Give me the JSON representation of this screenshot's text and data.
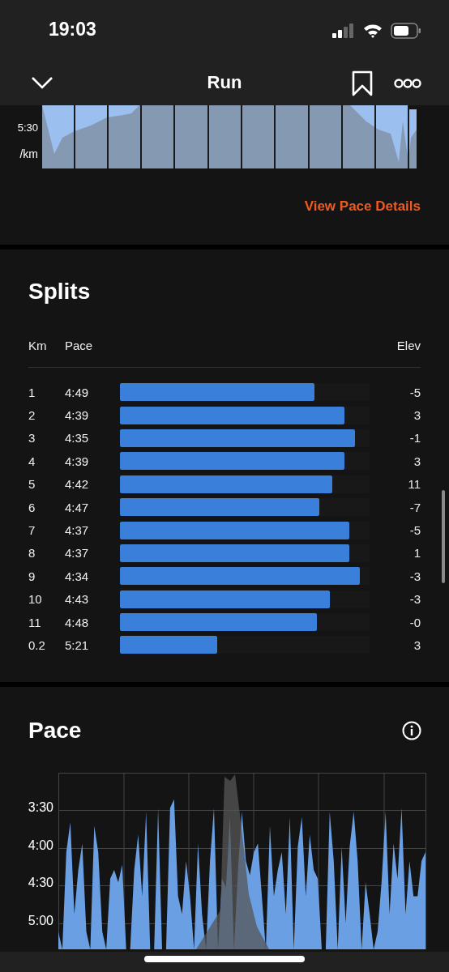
{
  "status_bar": {
    "time": "19:03"
  },
  "nav": {
    "title": "Run"
  },
  "pace_overview": {
    "axis_labels": [
      "5:30",
      "/km"
    ],
    "link": "View Pace Details"
  },
  "splits": {
    "title": "Splits",
    "columns": [
      "Km",
      "Pace",
      "Elev"
    ],
    "rows": [
      {
        "km": "1",
        "pace": "4:49",
        "level": 0.78,
        "elev": "-5"
      },
      {
        "km": "2",
        "pace": "4:39",
        "level": 0.9,
        "elev": "3"
      },
      {
        "km": "3",
        "pace": "4:35",
        "level": 0.94,
        "elev": "-1"
      },
      {
        "km": "4",
        "pace": "4:39",
        "level": 0.9,
        "elev": "3"
      },
      {
        "km": "5",
        "pace": "4:42",
        "level": 0.85,
        "elev": "11"
      },
      {
        "km": "6",
        "pace": "4:47",
        "level": 0.8,
        "elev": "-7"
      },
      {
        "km": "7",
        "pace": "4:37",
        "level": 0.92,
        "elev": "-5"
      },
      {
        "km": "8",
        "pace": "4:37",
        "level": 0.92,
        "elev": "1"
      },
      {
        "km": "9",
        "pace": "4:34",
        "level": 0.96,
        "elev": "-3"
      },
      {
        "km": "10",
        "pace": "4:43",
        "level": 0.84,
        "elev": "-3"
      },
      {
        "km": "11",
        "pace": "4:48",
        "level": 0.79,
        "elev": "-0"
      },
      {
        "km": "0.2",
        "pace": "5:21",
        "level": 0.39,
        "elev": "3"
      }
    ]
  },
  "pace": {
    "title": "Pace",
    "y_labels": [
      "3:30",
      "4:00",
      "4:30",
      "5:00"
    ]
  }
}
